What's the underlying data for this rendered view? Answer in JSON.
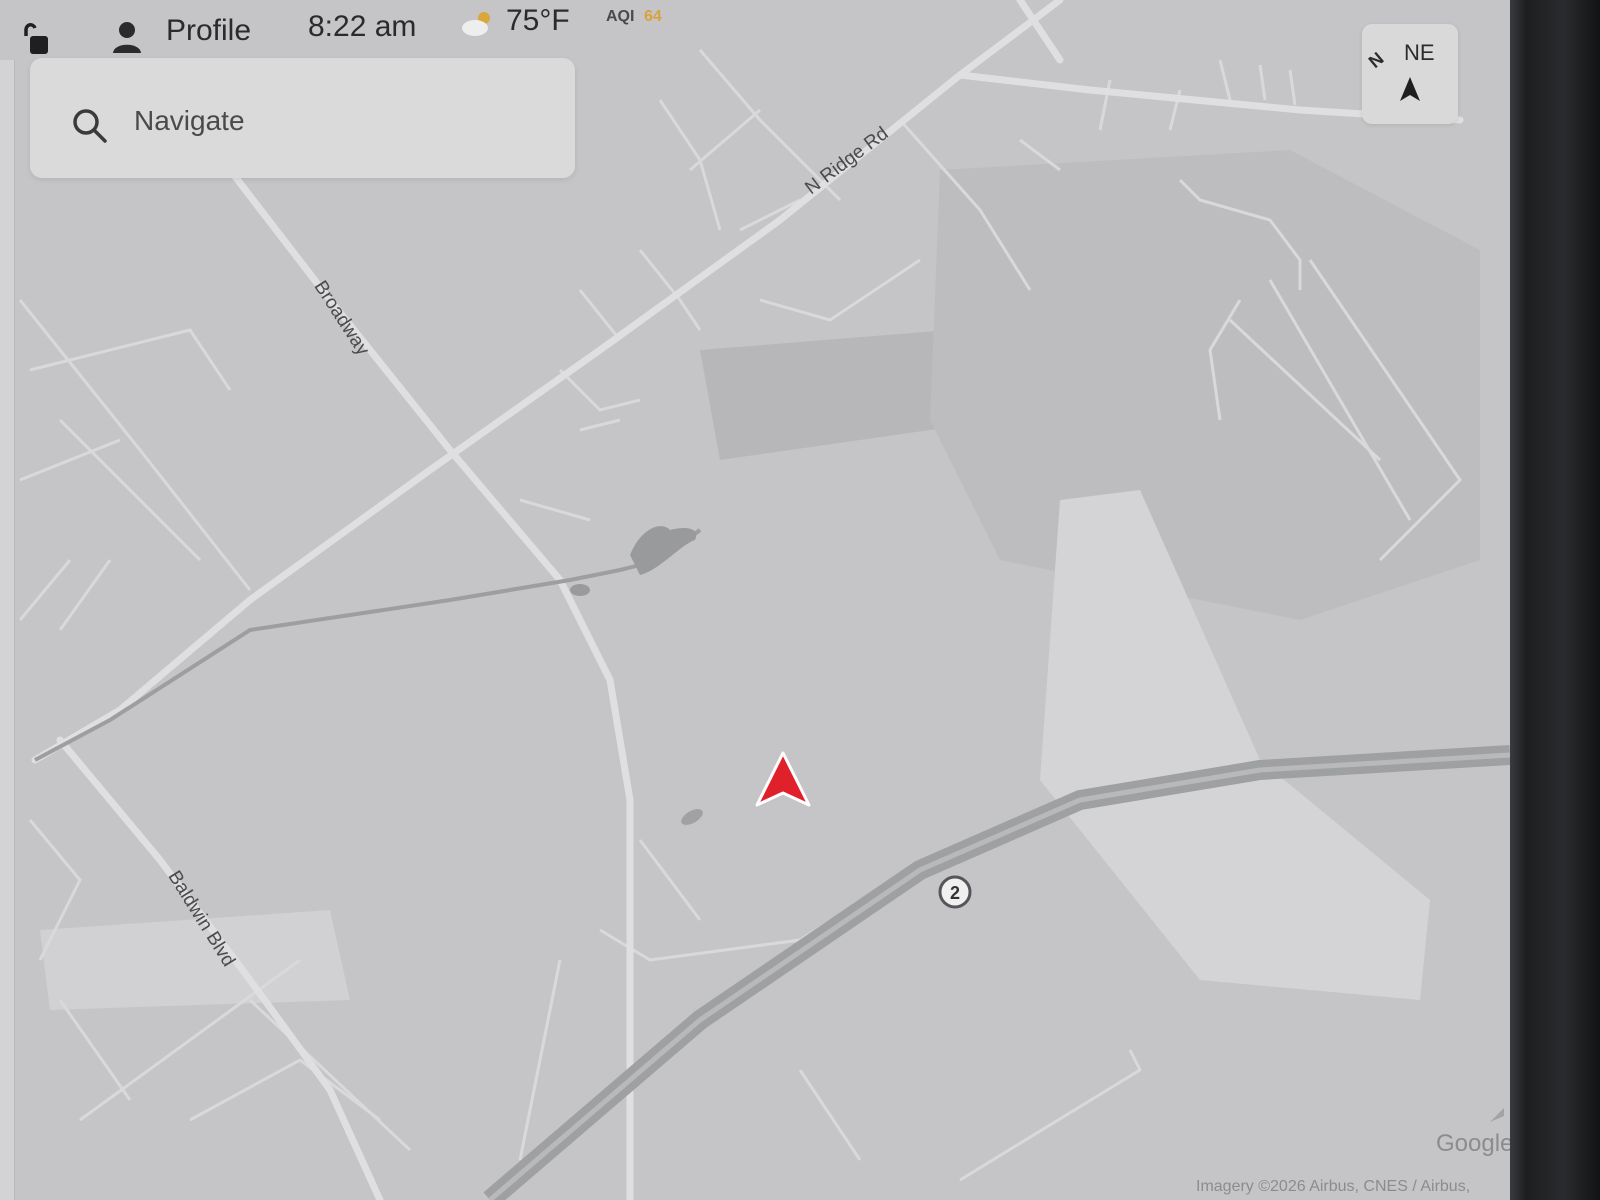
{
  "status_bar": {
    "lock_icon": "unlocked-padlock",
    "profile_label": "Profile",
    "time": "8:22 am",
    "weather_icon": "partly-cloudy-moon",
    "temperature": "75°F",
    "aqi_label": "AQI",
    "aqi_value": "64"
  },
  "search": {
    "placeholder": "Navigate"
  },
  "compass": {
    "north_label": "N",
    "heading_label": "NE"
  },
  "map": {
    "road_labels": {
      "n_ridge_rd": "N Ridge Rd",
      "broadway": "Broadway",
      "baldwin_blvd": "Baldwin Blvd"
    },
    "route_shield": "2",
    "vehicle_marker_color": "#e0202a",
    "provider_logo": "Google",
    "attribution": "Imagery ©2026 Airbus, CNES / Airbus,"
  }
}
